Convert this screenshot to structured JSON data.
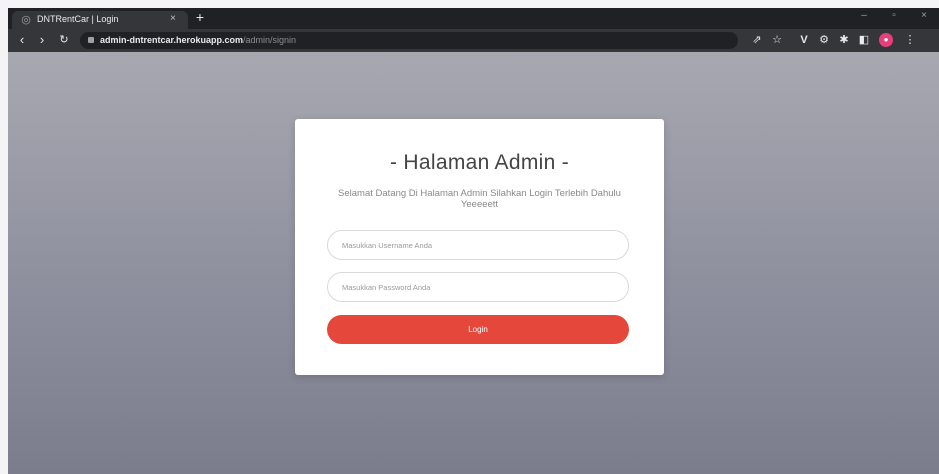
{
  "browser": {
    "tab_title": "DNTRentCar | Login",
    "url_host": "admin-dntrentcar.herokuapp.com",
    "url_path": "/admin/signin",
    "icons": {
      "favicon": "globe-icon",
      "close": "close-icon",
      "new_tab": "plus-icon",
      "back": "arrow-left-icon",
      "forward": "arrow-right-icon",
      "reload": "reload-icon",
      "lock": "lock-icon",
      "share": "share-icon",
      "star": "star-icon",
      "extension_v": "vue-extension-icon",
      "extension_gear": "settings-extension-icon",
      "extension_puzzle": "puzzle-icon",
      "sidebar": "sidebar-icon",
      "profile": "profile-avatar-icon",
      "menu": "kebab-menu-icon"
    },
    "glyphs": {
      "close": "×",
      "new_tab": "+",
      "minimize": "–",
      "restore": "▫",
      "window_close": "×",
      "back": "‹",
      "forward": "›",
      "reload": "↻",
      "share": "⇗",
      "star": "☆",
      "extension_v": "V",
      "extension_gear": "⚙",
      "extension_puzzle": "✱",
      "sidebar": "◧",
      "profile": "●",
      "menu": "⋮"
    }
  },
  "login": {
    "title": "- Halaman Admin -",
    "subtitle": "Selamat Datang Di Halaman Admin Silahkan Login Terlebih Dahulu Yeeeeett",
    "username_placeholder": "Masukkan Username Anda",
    "password_placeholder": "Masukkan Password Anda",
    "button_label": "Login",
    "accent_color": "#e5483a"
  }
}
